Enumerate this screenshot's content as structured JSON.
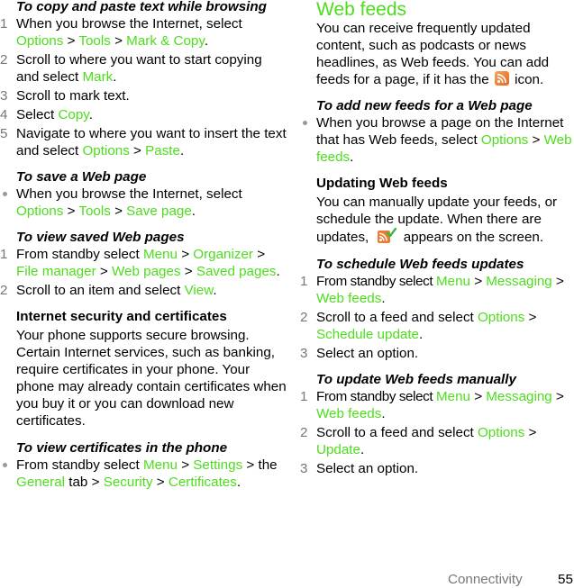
{
  "left": {
    "copy_paste": {
      "heading": "To copy and paste text while browsing",
      "steps": [
        {
          "num": "1",
          "t1": "When you browse the Internet, select ",
          "g1": "Options",
          "s1": " > ",
          "g2": "Tools",
          "s2": " > ",
          "g3": "Mark & Copy",
          "end": "."
        },
        {
          "num": "2",
          "t1": "Scroll to where you want to start copying and select ",
          "g1": "Mark",
          "end": "."
        },
        {
          "num": "3",
          "t1": "Scroll to mark text."
        },
        {
          "num": "4",
          "t1": "Select ",
          "g1": "Copy",
          "end": "."
        },
        {
          "num": "5",
          "t1": "Navigate to where you want to insert the text and select ",
          "g1": "Options",
          "s1": " > ",
          "g2": "Paste",
          "end": "."
        }
      ]
    },
    "save_page": {
      "heading": "To save a Web page",
      "bullet": {
        "t1": "When you browse the Internet, select ",
        "g1": "Options",
        "s1": " > ",
        "g2": "Tools",
        "s2": " > ",
        "g3": "Save page",
        "end": "."
      }
    },
    "view_saved": {
      "heading": "To view saved Web pages",
      "steps": [
        {
          "num": "1",
          "t1": "From standby select ",
          "g1": "Menu",
          "s1": " > ",
          "g2": "Organizer",
          "s2": " > ",
          "g3": "File manager",
          "s3": " > ",
          "g4": "Web pages",
          "s4": " > ",
          "g5": "Saved pages",
          "end": "."
        },
        {
          "num": "2",
          "t1": "Scroll to an item and select ",
          "g1": "View",
          "end": "."
        }
      ]
    },
    "security": {
      "heading": "Internet security and certificates",
      "body": "Your phone supports secure browsing. Certain Internet services, such as banking, require certificates in your phone. Your phone may already contain certificates when you buy it or you can download new certificates."
    },
    "view_certs": {
      "heading": "To view certificates in the phone",
      "bullet": {
        "t1": "From standby select ",
        "g1": "Menu",
        "s1": " > ",
        "g2": "Settings",
        "s2": " > the ",
        "g3": "General",
        "s3": " tab > ",
        "g4": "Security",
        "s4": " > ",
        "g5": "Certificates",
        "end": "."
      }
    }
  },
  "right": {
    "web_feeds": {
      "heading": "Web feeds",
      "body_before_icon": "You can receive frequently updated content, such as podcasts or news headlines, as Web feeds. You can add feeds for a page, if it has the ",
      "icon": "rss-feed-icon",
      "body_after_icon": " icon."
    },
    "add_feeds": {
      "heading": "To add new feeds for a Web page",
      "bullet": {
        "t1": "When you browse a page on the Internet that has Web feeds, select ",
        "g1": "Options",
        "s1": " > ",
        "g2": "Web feeds",
        "end": "."
      }
    },
    "updating": {
      "heading": "Updating Web feeds",
      "body_before_icon": "You can manually update your feeds, or schedule the update. When there are updates, ",
      "icon": "rss-feed-updated-icon",
      "body_after_icon": " appears on the screen."
    },
    "schedule": {
      "heading": "To schedule Web feeds updates",
      "steps": [
        {
          "num": "1",
          "t1": "From standby select ",
          "g1": "Menu",
          "s1": " > ",
          "g2": "Messaging",
          "s2": " > ",
          "g3": "Web feeds",
          "end": "."
        },
        {
          "num": "2",
          "t1": "Scroll to a feed and select ",
          "g1": "Options",
          "s1": " > ",
          "g2": "Schedule update",
          "end": "."
        },
        {
          "num": "3",
          "t1": "Select an option."
        }
      ]
    },
    "manual": {
      "heading": "To update Web feeds manually",
      "steps": [
        {
          "num": "1",
          "t1": "From standby select ",
          "g1": "Menu",
          "s1": " > ",
          "g2": "Messaging",
          "s2": " > ",
          "g3": "Web feeds",
          "end": "."
        },
        {
          "num": "2",
          "t1": "Scroll to a feed and select ",
          "g1": "Options",
          "s1": " > ",
          "g2": "Update",
          "end": "."
        },
        {
          "num": "3",
          "t1": "Select an option."
        }
      ]
    }
  },
  "footer": {
    "section": "Connectivity",
    "page": "55"
  },
  "colors": {
    "menu_green": "#4ddd1c",
    "step_number_gray": "#777777",
    "rss_orange": "#e8671f"
  }
}
